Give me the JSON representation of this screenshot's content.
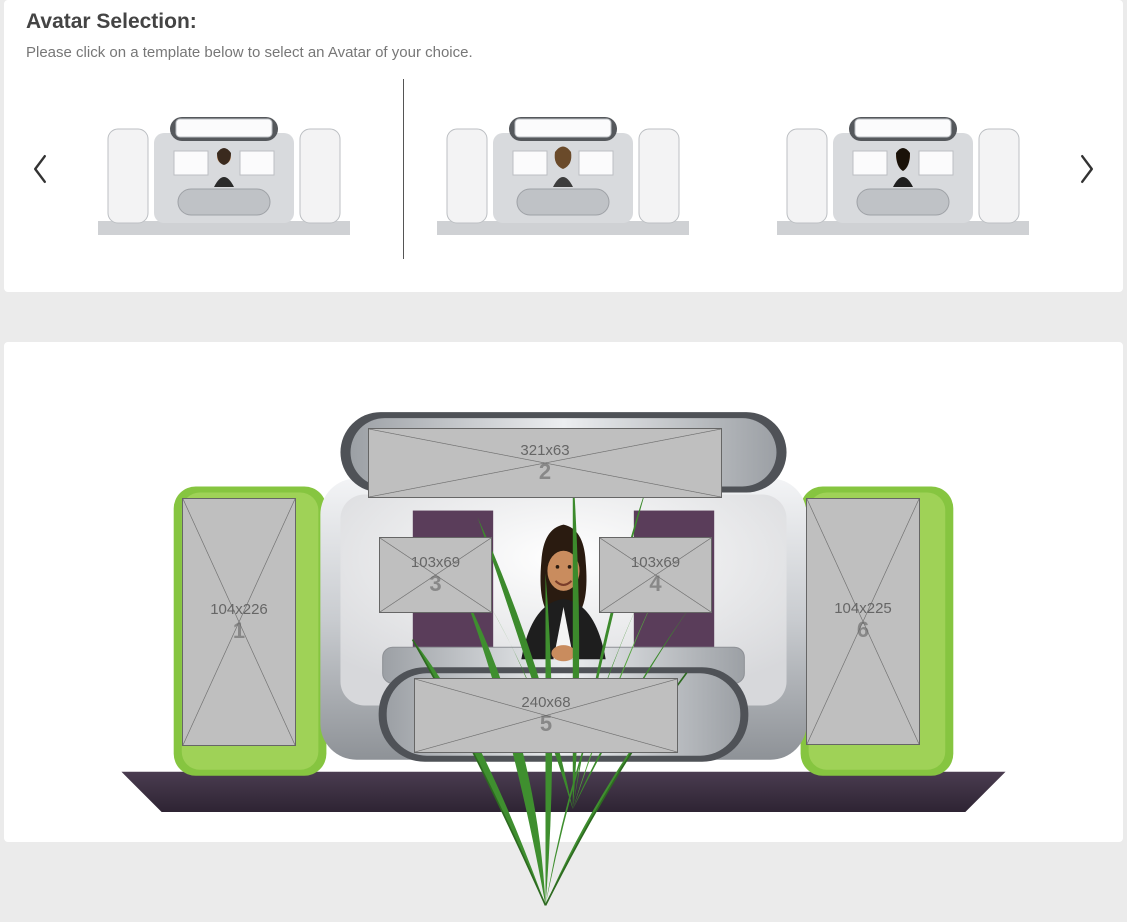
{
  "section": {
    "title": "Avatar Selection:",
    "subtitle": "Please click on a template below to select an Avatar of your choice."
  },
  "carousel": {
    "prev_label": "Previous",
    "next_label": "Next",
    "thumbs": [
      {
        "id": "avatar-1",
        "selected": true
      },
      {
        "id": "avatar-2",
        "selected": false
      },
      {
        "id": "avatar-3",
        "selected": false
      }
    ]
  },
  "placeholders": [
    {
      "n": "1",
      "dim": "104x226"
    },
    {
      "n": "2",
      "dim": "321x63"
    },
    {
      "n": "3",
      "dim": "103x69"
    },
    {
      "n": "4",
      "dim": "103x69"
    },
    {
      "n": "5",
      "dim": "240x68"
    },
    {
      "n": "6",
      "dim": "104x225"
    }
  ],
  "colors": {
    "booth_accent": "#86c540",
    "booth_metal_light": "#e9e9eb",
    "booth_metal_mid": "#b9bcc0",
    "booth_metal_dark": "#55585c",
    "stage_floor": "#3a2d3f",
    "panel_purple": "#5a3d5a"
  }
}
